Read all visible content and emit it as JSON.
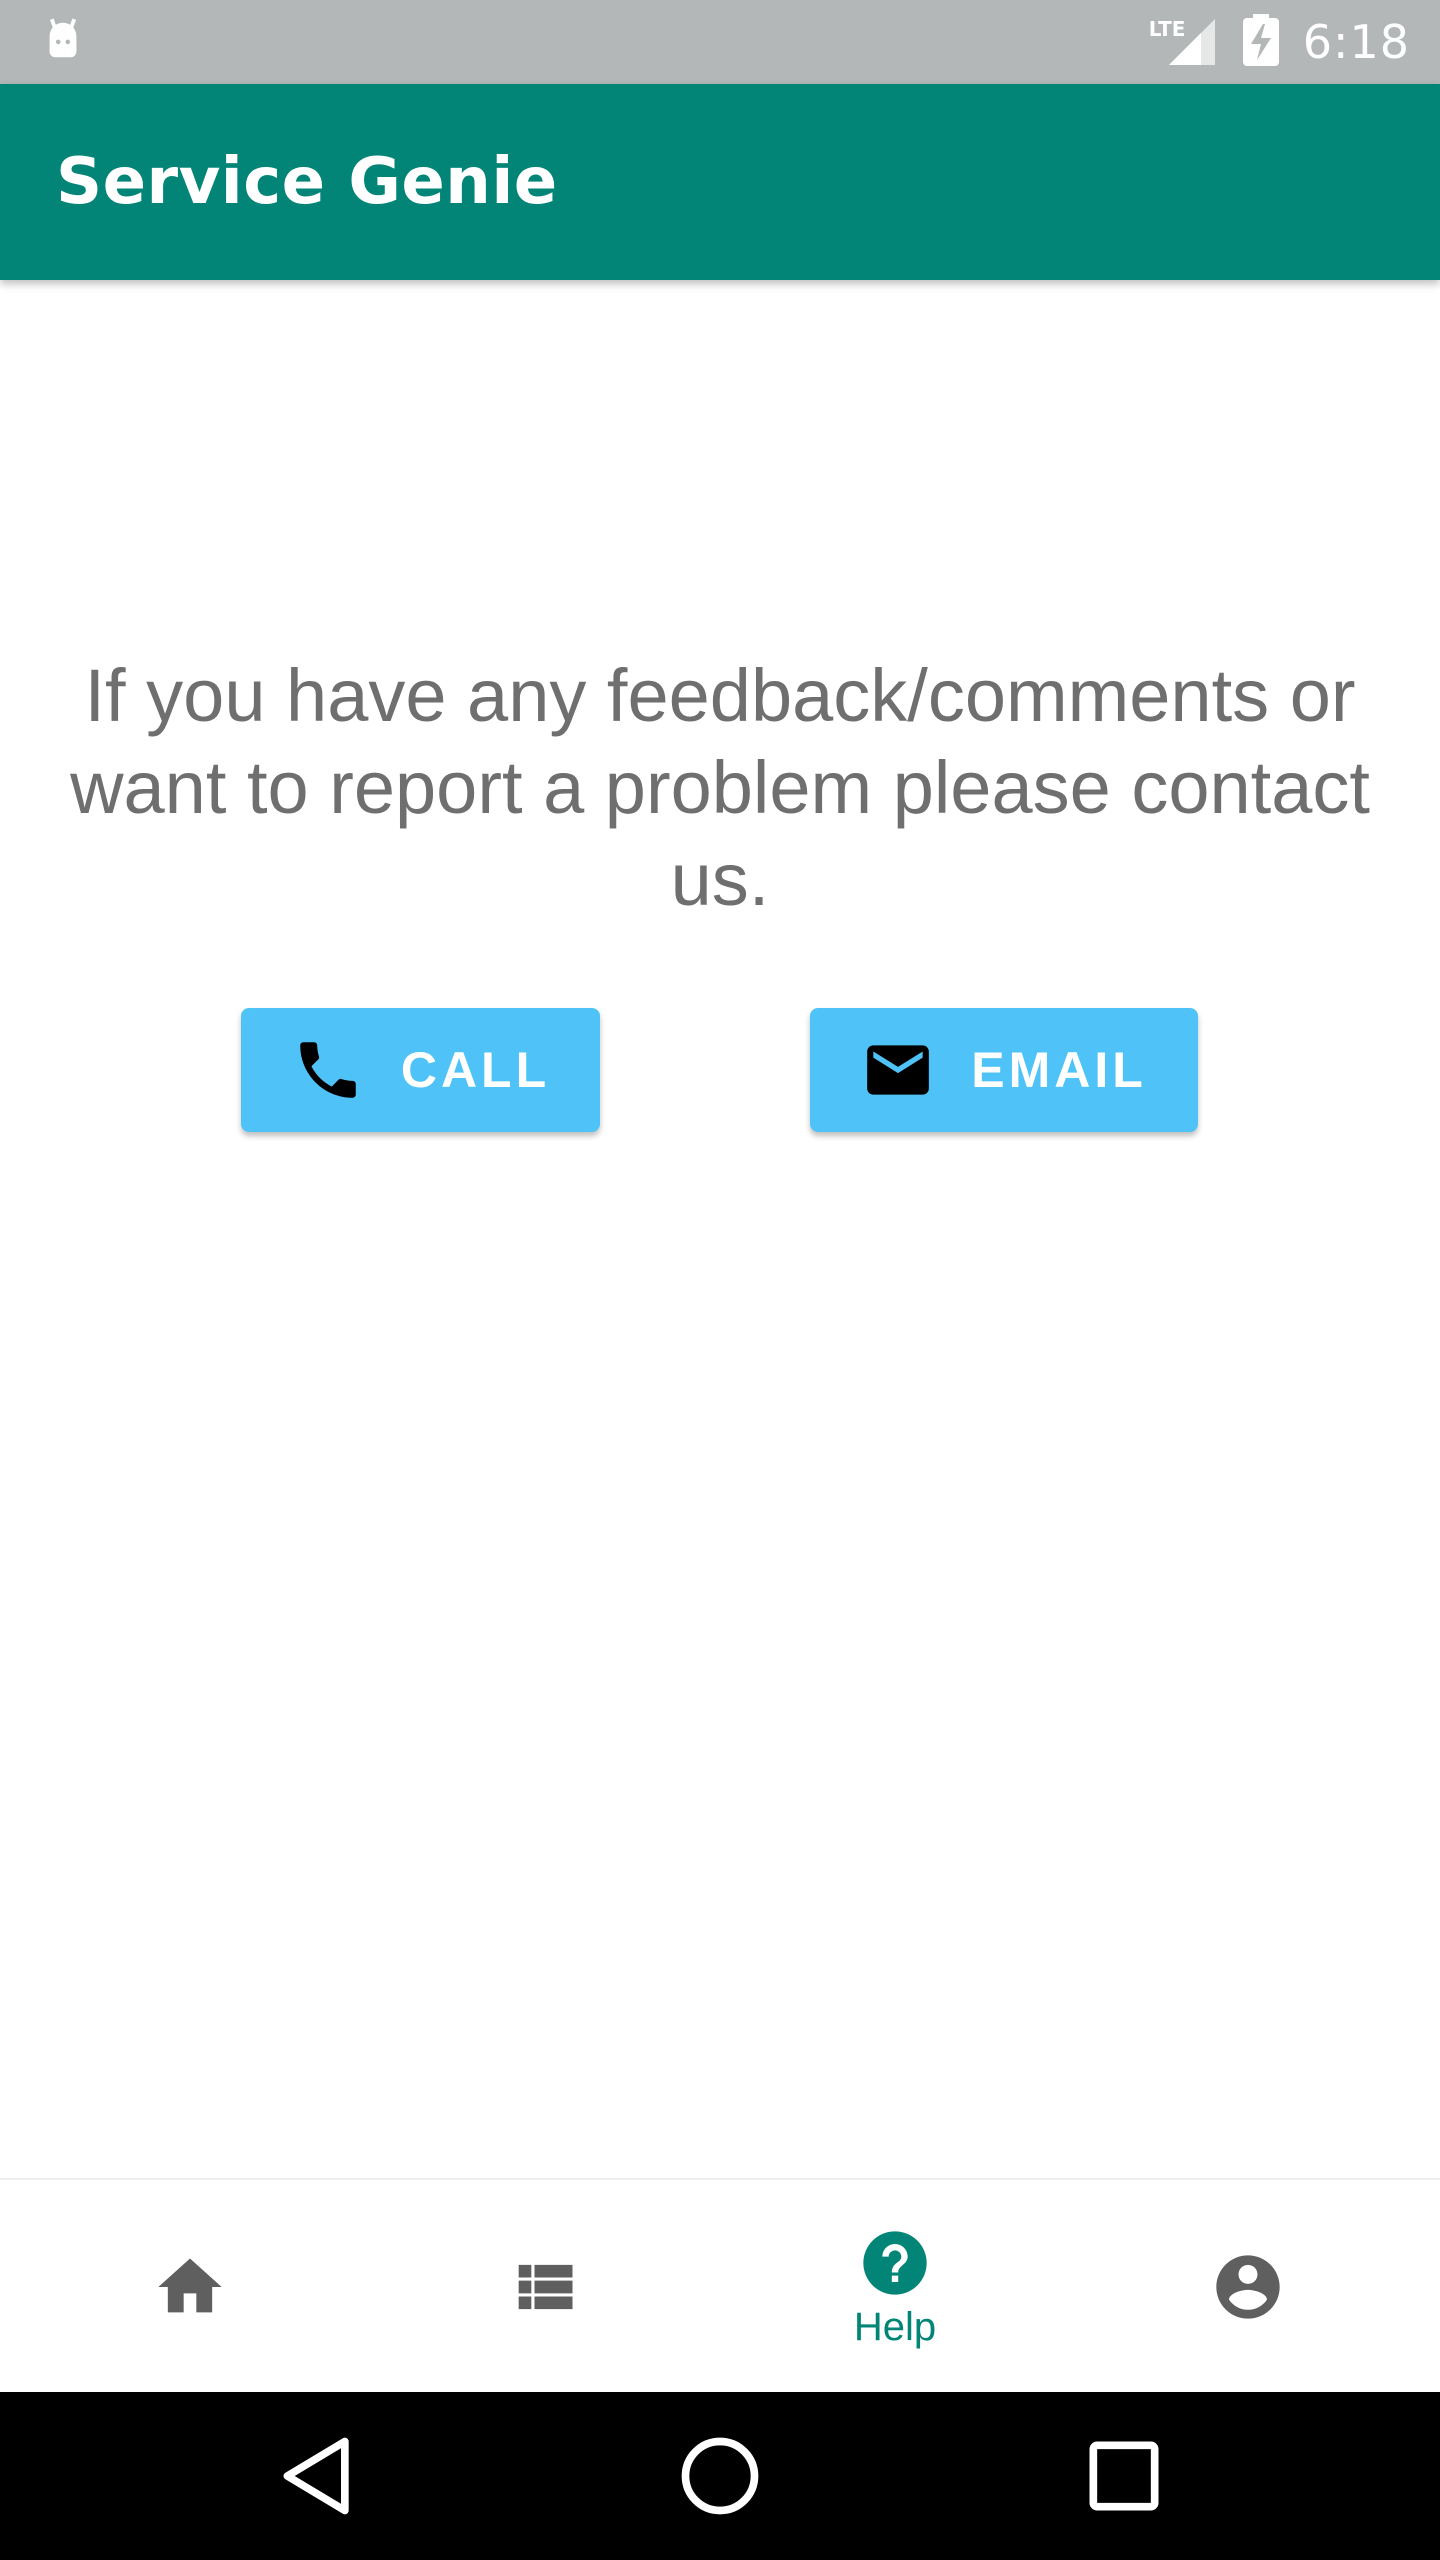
{
  "status_bar": {
    "network_label": "LTE",
    "time": "6:18",
    "icons": [
      "android-notification-icon",
      "signal-icon",
      "battery-charging-icon"
    ]
  },
  "app_bar": {
    "title": "Service Genie"
  },
  "content": {
    "message": "If you have any feedback/comments or want to report a problem please contact us.",
    "call_label": "CALL",
    "email_label": "EMAIL"
  },
  "bottom_nav": {
    "items": [
      {
        "icon": "home-icon",
        "label": "",
        "active": false
      },
      {
        "icon": "list-icon",
        "label": "",
        "active": false
      },
      {
        "icon": "help-icon",
        "label": "Help",
        "active": true
      },
      {
        "icon": "account-icon",
        "label": "",
        "active": false
      }
    ]
  },
  "colors": {
    "primary": "#028577",
    "button": "#4fc3f7",
    "text_gray": "#6f6f6f",
    "status_bar": "#b3b7b7",
    "nav_inactive": "#5f5f5f"
  }
}
